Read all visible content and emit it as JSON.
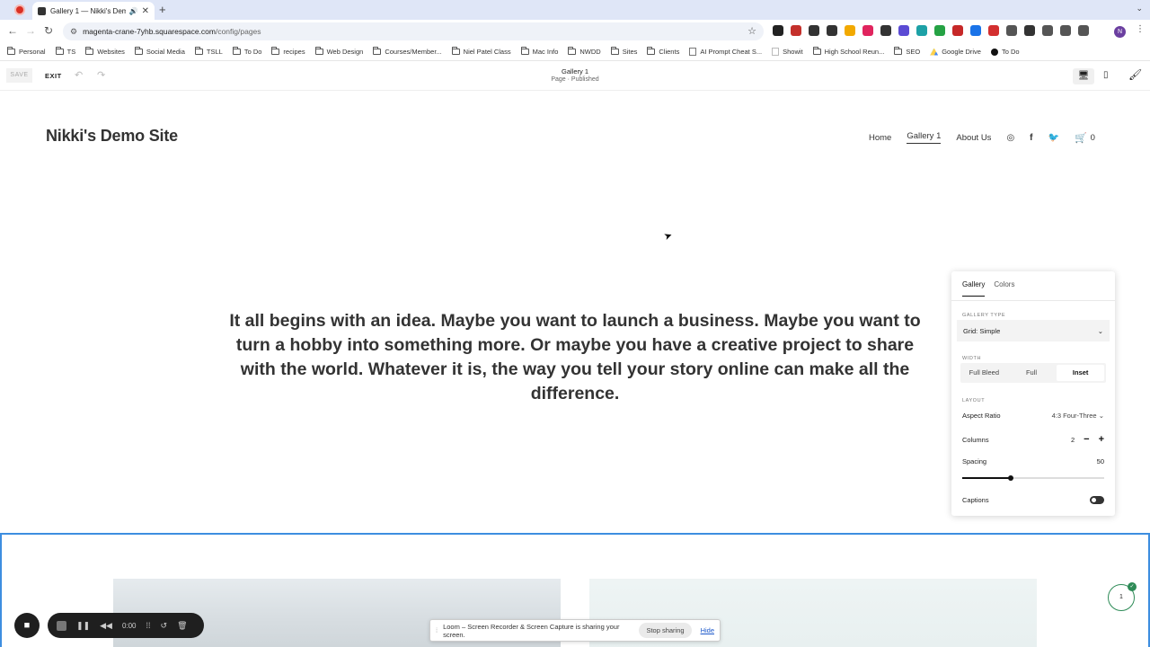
{
  "browser": {
    "tab_title": "Gallery 1 — Nikki's Demo",
    "url_host": "magenta-crane-7yhb.squarespace.com",
    "url_path": "/config/pages",
    "bookmarks": [
      {
        "label": "Personal",
        "icon": "folder-icon"
      },
      {
        "label": "TS",
        "icon": "folder-icon"
      },
      {
        "label": "Websites",
        "icon": "folder-icon"
      },
      {
        "label": "Social Media",
        "icon": "folder-icon"
      },
      {
        "label": "TSLL",
        "icon": "folder-icon"
      },
      {
        "label": "To Do",
        "icon": "folder-icon"
      },
      {
        "label": "recipes",
        "icon": "folder-icon"
      },
      {
        "label": "Web Design",
        "icon": "folder-icon"
      },
      {
        "label": "Courses/Member...",
        "icon": "folder-icon"
      },
      {
        "label": "Niel Patel Class",
        "icon": "folder-icon"
      },
      {
        "label": "Mac Info",
        "icon": "folder-icon"
      },
      {
        "label": "NWDD",
        "icon": "folder-icon"
      },
      {
        "label": "Sites",
        "icon": "folder-icon"
      },
      {
        "label": "Clients",
        "icon": "folder-icon"
      },
      {
        "label": "AI Prompt Cheat S...",
        "icon": "doc-icon"
      },
      {
        "label": "Showit",
        "icon": "doc-icon"
      },
      {
        "label": "High School Reun...",
        "icon": "folder-icon"
      },
      {
        "label": "SEO",
        "icon": "folder-icon"
      },
      {
        "label": "Google Drive",
        "icon": "google-drive-icon"
      },
      {
        "label": "To Do",
        "icon": "todo-icon"
      }
    ],
    "profile_initial": "N",
    "extension_colors": [
      "#222222",
      "#c4302b",
      "#333333",
      "#333333",
      "#f2a900",
      "#e0245e",
      "#333333",
      "#5b4bd4",
      "#1da1a6",
      "#25a244",
      "#c62828",
      "#1a73e8",
      "#d32f2f",
      "#555555",
      "#333333",
      "#555555",
      "#555555",
      "#555555"
    ]
  },
  "editor": {
    "save_label": "SAVE",
    "exit_label": "EXIT",
    "page_title": "Gallery 1",
    "page_status": "Page · Published"
  },
  "site": {
    "title": "Nikki's Demo Site",
    "nav": [
      {
        "label": "Home",
        "active": false
      },
      {
        "label": "Gallery 1",
        "active": true
      },
      {
        "label": "About Us",
        "active": false
      }
    ],
    "cart_count": "0",
    "hero_text": "It all begins with an idea. Maybe you want to launch a business. Maybe you want to turn a hobby into something more. Or maybe you have a creative project to share with the world. Whatever it is, the way you tell your story online can make all the difference."
  },
  "panel": {
    "tabs": [
      "Gallery",
      "Colors"
    ],
    "active_tab": "Gallery",
    "gallery_type_label": "GALLERY TYPE",
    "gallery_type_value": "Grid: Simple",
    "width_label": "WIDTH",
    "width_options": [
      "Full Bleed",
      "Full",
      "Inset"
    ],
    "width_selected": "Inset",
    "layout_label": "LAYOUT",
    "aspect_ratio_label": "Aspect Ratio",
    "aspect_ratio_value": "4:3 Four-Three",
    "columns_label": "Columns",
    "columns_value": "2",
    "spacing_label": "Spacing",
    "spacing_value": "50",
    "spacing_fraction": 0.34,
    "captions_label": "Captions",
    "captions_on": false
  },
  "gallery": {
    "badge_count": "1"
  },
  "loom": {
    "timer": "0:00",
    "share_message": "Loom – Screen Recorder & Screen Capture is sharing your screen.",
    "stop_label": "Stop sharing",
    "hide_label": "Hide"
  }
}
